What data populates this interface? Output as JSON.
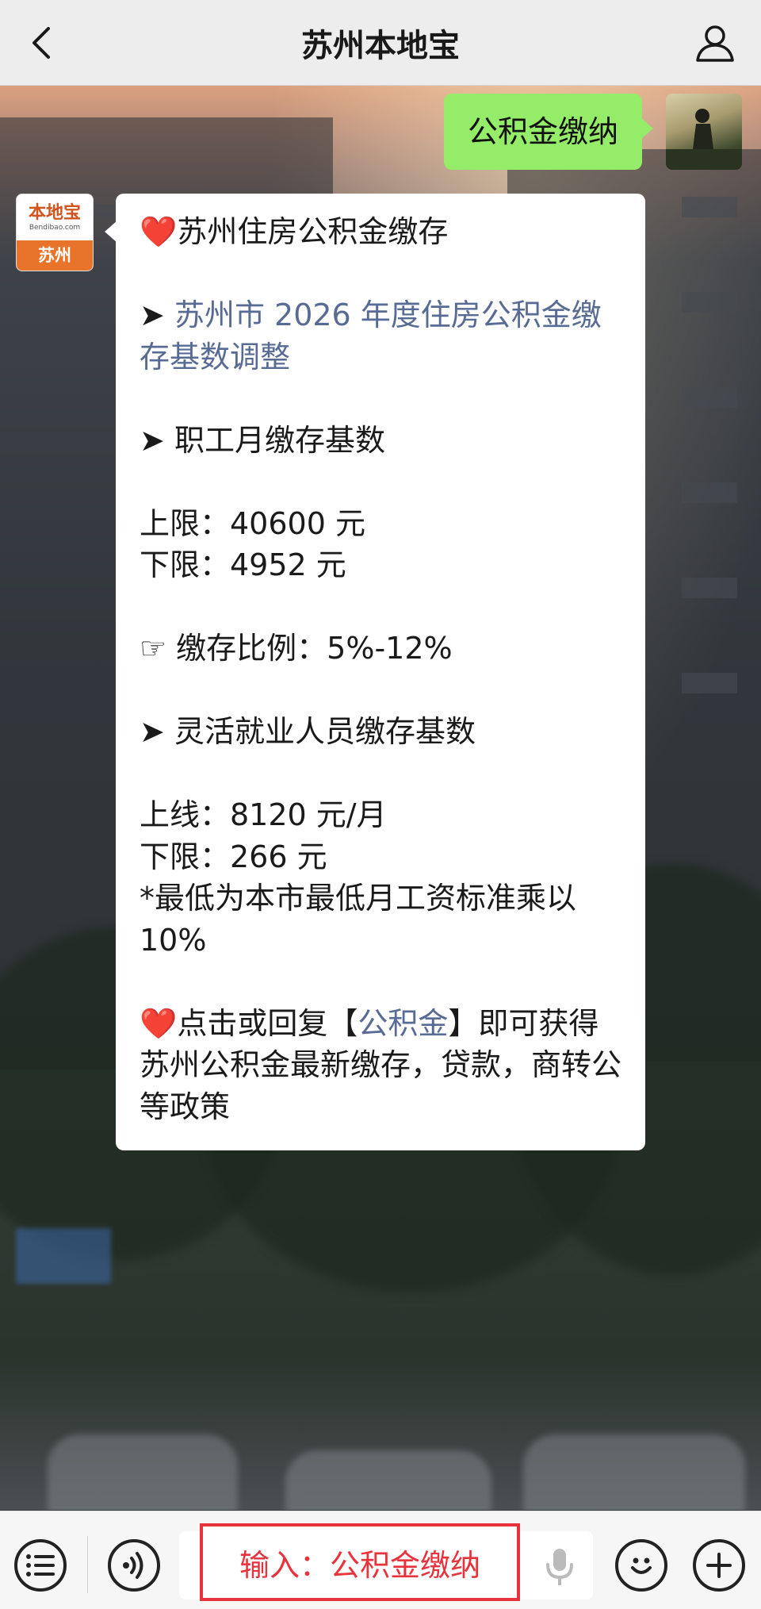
{
  "header": {
    "title": "苏州本地宝"
  },
  "user_message": {
    "text": "公积金缴纳"
  },
  "bot": {
    "avatar": {
      "logo_text": "本地宝",
      "logo_url": "Bendibao.com",
      "logo_city": "苏州"
    },
    "message": {
      "heart_icon": "❤️",
      "heading": "苏州住房公积金缴存",
      "arrow": "➤",
      "link_title": "苏州市 2026 年度住房公积金缴存基数调整",
      "section1_title": "职工月缴存基数",
      "upper_limit": "上限：40600 元",
      "lower_limit": "下限：4952 元",
      "ratio_icon": "☞",
      "ratio": "缴存比例：5%-12%",
      "section2_title": "灵活就业人员缴存基数",
      "flex_upper": "上线：8120 元/月",
      "flex_lower": "下限：266 元",
      "note": "*最低为本市最低月工资标准乘以10%",
      "footer_pre": "点击或回复【",
      "footer_link": "公积金",
      "footer_post": "】即可获得苏州公积金最新缴存，贷款，商转公等政策"
    }
  },
  "input_bar": {
    "hint": "输入：公积金缴纳",
    "hint_color": "#e8323c",
    "icons": [
      "menu-list-icon",
      "voice-icon",
      "mic-icon",
      "emoji-icon",
      "plus-icon"
    ]
  }
}
